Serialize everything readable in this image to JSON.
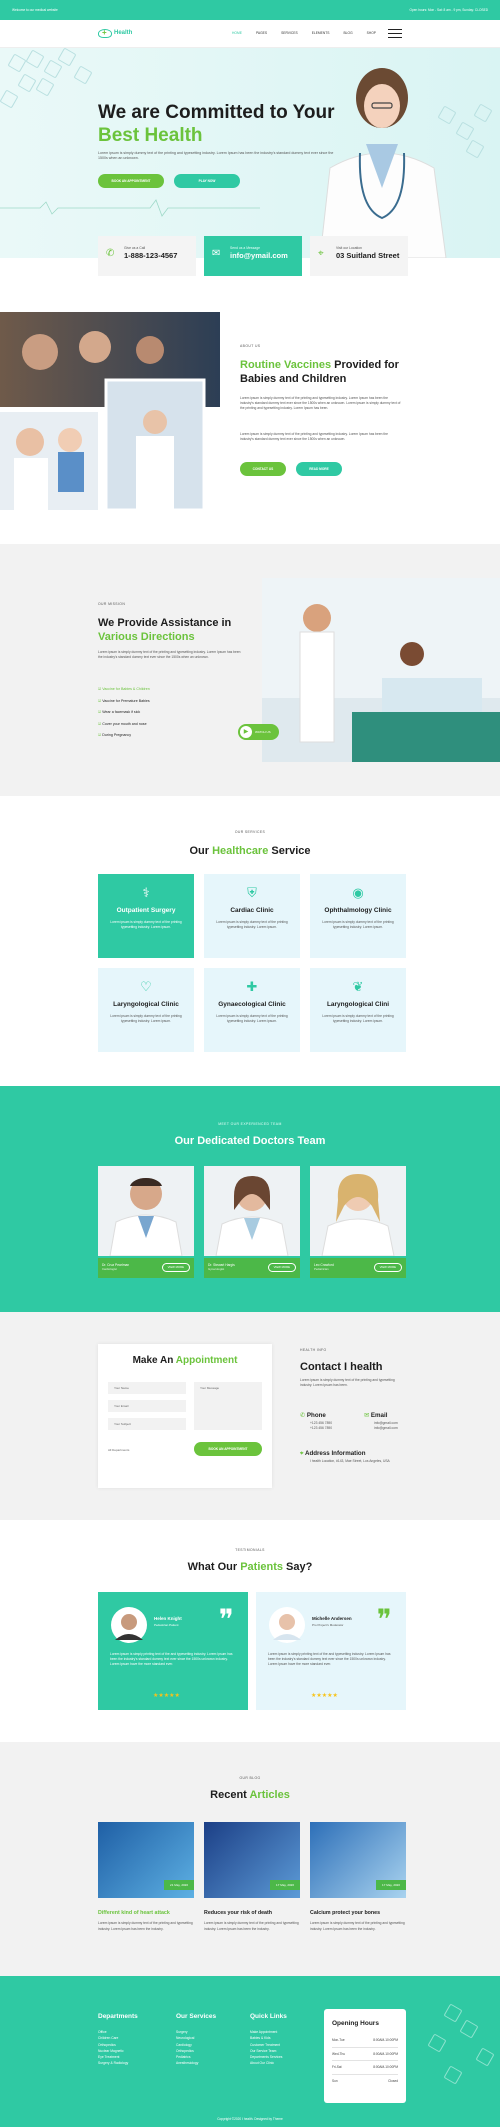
{
  "topbar": {
    "welcome": "Welcome to our medical website",
    "hours": "Open hours: Mon - Sat: 8 am - 9 pm, Sunday: CLOSED"
  },
  "nav": {
    "logo": "Health",
    "items": [
      "HOME",
      "PAGES",
      "SERVICES",
      "ELEMENTS",
      "BLOG",
      "SHOP"
    ]
  },
  "hero": {
    "title_line1": "We are Committed to Your",
    "title_line2": "Best Health",
    "text": "Lorem ipsum is simply dummy text of the printing and typesetting industry. Lorem Ipsum has been the industry's standard dummy text ever since the 1500s when an unknown.",
    "btn1": "BOOK AN APPOINTMENT",
    "btn2": "PLAY NOW"
  },
  "contacts": [
    {
      "icon": "phone-icon",
      "label": "Give us a Call",
      "value": "1-888-123-4567"
    },
    {
      "icon": "envelope-icon",
      "label": "Send us a Message",
      "value": "info@ymail.com"
    },
    {
      "icon": "location-icon",
      "label": "Visit our Location",
      "value": "03 Suitland Street"
    }
  ],
  "about": {
    "eyebrow": "ABOUT US",
    "title_green": "Routine Vaccines",
    "title_rest": " Provided for Babies and Children",
    "p1": "Lorem ipsum is simply dummy text of the printing and typesetting industry. Lorem Ipsum has been the industry's standard dummy text ever since the 1500s when an unknown. Lorem ipsum is simply dummy text of the printing and typesetting industry. Lorem Ipsum has been.",
    "p2": "Lorem ipsum is simply dummy text of the printing and typesetting industry. Lorem Ipsum has been the industry's standard dummy text ever since the 1500s when an unknown.",
    "btn1": "CONTACT US",
    "btn2": "READ MORE"
  },
  "mission": {
    "eyebrow": "OUR MISSION",
    "title1": "We Provide Assistance in",
    "title2": "Various Directions",
    "text": "Lorem ipsum is simply dummy text of the printing and typesetting industry. Lorem Ipsum has been the industry's standard dummy text ever since the 1500s when an unknown.",
    "items": [
      "Vaccine for Babies & Children",
      "Vaccine for Premature Babies",
      "Wear a facemask if sick",
      "Cover your mouth and nose",
      "During Pregnancy"
    ],
    "video": "WATCH US"
  },
  "services": {
    "eyebrow": "OUR SERVICES",
    "title_a": "Our ",
    "title_b": "Healthcare",
    "title_c": " Service",
    "text": "Lorem ipsum is simply dummy text of the printing typesetting industry. Lorem ipsum.",
    "items": [
      {
        "icon": "stethoscope-icon",
        "name": "Outpatient Surgery"
      },
      {
        "icon": "bed-icon",
        "name": "Cardiac Clinic"
      },
      {
        "icon": "eye-icon",
        "name": "Ophthalmology Clinic"
      },
      {
        "icon": "heartbeat-icon",
        "name": "Laryngological Clinic"
      },
      {
        "icon": "medicine-icon",
        "name": "Gynaecological Clinic"
      },
      {
        "icon": "hand-heart-icon",
        "name": "Laryngological Clini"
      }
    ]
  },
  "team": {
    "eyebrow": "MEET OUR EXPERIENCED TEAM",
    "title": "Our Dedicated Doctors Team",
    "btn": "VIEW MORE",
    "doctors": [
      {
        "name": "Dr. Cruz Pearlman",
        "role": "Cardiologist"
      },
      {
        "name": "Dr. Stewart Hargis",
        "role": "Gynecologist"
      },
      {
        "name": "Leo Crawford",
        "role": "Pediatrician"
      }
    ]
  },
  "appointment": {
    "title_a": "Make An ",
    "title_b": "Appointment",
    "name": "Your Name",
    "email": "Your Email",
    "subject": "Your Subject",
    "message": "Your Message",
    "dept": "All Departments",
    "btn": "BOOK AN APPOINTMENT"
  },
  "contact": {
    "eyebrow": "HEALTH INFO",
    "title": "Contact I health",
    "text": "Lorem ipsum is simply dummy text of the printing and typesetting industry. Lorem Ipsum has been.",
    "phone_label": "Phone",
    "phones": [
      "+123 456 7890",
      "+123 456 7890"
    ],
    "email_label": "Email",
    "emails": [
      "info@gmail.com",
      "info@gmail.com"
    ],
    "address_label": "Address Information",
    "address": "I health Location, #143, Mae Street, Los Angeles, USA"
  },
  "testimonials": {
    "eyebrow": "TESTIMONIALS",
    "title_a": "What Our ",
    "title_b": "Patients",
    "title_c": " Say?",
    "items": [
      {
        "name": "Helen Knight",
        "role": "Pedestrian Patient",
        "text": "Lorem ipsum is simply printing text of the and typesetting industry. Lorem Ipsum has been the industry's standard dummy text ever since the 1500s unknown industry. Lorem Ipsum have the more standard ever."
      },
      {
        "name": "Michelle Andersen",
        "role": "Pro Project's Moderator",
        "text": "Lorem ipsum is simply printing text of the and typesetting industry. Lorem Ipsum has been the industry's standard dummy text ever since the 1500s unknown industry. Lorem Ipsum have the more standard ever."
      }
    ]
  },
  "blog": {
    "eyebrow": "OUR BLOG",
    "title_a": "Recent ",
    "title_b": "Articles",
    "text": "Lorem ipsum is simply dummy text of the printing and typesetting industry. Lorem Ipsum has been the industry.",
    "items": [
      {
        "date": "21 May, 2020",
        "title": "Different kind of heart attack"
      },
      {
        "date": "17 May, 2020",
        "title": "Reduces your risk of death"
      },
      {
        "date": "17 May, 2020",
        "title": "Calcium protect your bones"
      }
    ]
  },
  "footer": {
    "cols": [
      {
        "title": "Departments",
        "items": [
          "Office",
          "Children Care",
          "Orthopedics",
          "Nuclear Magnetic",
          "Eye Treatment",
          "Surgery & Radiology"
        ]
      },
      {
        "title": "Our Services",
        "items": [
          "Surgery",
          "Neurological",
          "Cardiology",
          "Orthopedics",
          "Pediatrics",
          "Anesthesiology"
        ]
      },
      {
        "title": "Quick Links",
        "items": [
          "Make Appointment",
          "Babies & Kids",
          "Customer Treatment",
          "Our Service Team",
          "Departments Services",
          "About Our Clinic"
        ]
      }
    ],
    "hours_title": "Opening Hours",
    "hours": [
      {
        "day": "Mon-Tue",
        "time": "8:00AM-10:00PM"
      },
      {
        "day": "Wed-Thu",
        "time": "8:00AM-10:00PM"
      },
      {
        "day": "Fri-Sat",
        "time": "8:00AM-10:00PM"
      },
      {
        "day": "Sun",
        "time": "Closed"
      }
    ],
    "copyright": "Copyright ©2020 I health. Designed by Theme"
  }
}
